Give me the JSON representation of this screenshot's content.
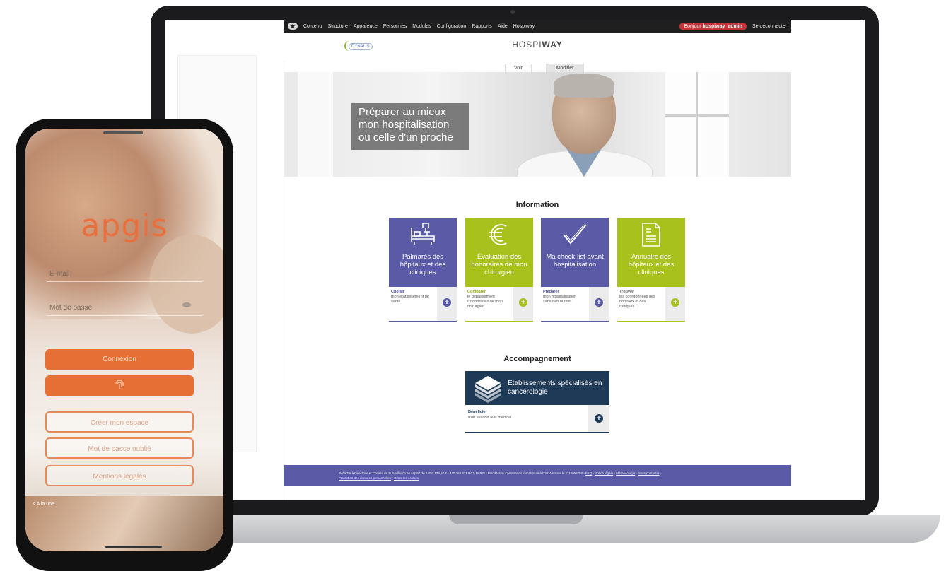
{
  "toolbar": {
    "items": [
      "Contenu",
      "Structure",
      "Apparence",
      "Personnes",
      "Modules",
      "Configuration",
      "Rapports",
      "Aide",
      "Hospiway"
    ],
    "greeting_prefix": "Bonjour",
    "user": "hospiway_admin",
    "logout": "Se déconnecter"
  },
  "header": {
    "logo": "DYNALIS",
    "title_part1": "HOSPI",
    "title_part2": "WAY"
  },
  "tabs": {
    "view": "Voir",
    "edit": "Modifier"
  },
  "hero": {
    "line1": "Préparer au mieux",
    "line2": "mon hospitalisation",
    "line3": "ou celle d'un proche"
  },
  "information": {
    "title": "Information",
    "cards": [
      {
        "title": "Palmarès des hôpitaux et des cliniques",
        "action": "Choisir",
        "desc": "mon établissement de santé",
        "icon": "hospital-bed-icon",
        "color": "#5a5aa6"
      },
      {
        "title": "Évaluation des honoraires de mon chirurgien",
        "action": "Comparer",
        "desc": "le dépassement d'honoraires de mon chirurgien",
        "icon": "euro-icon",
        "color": "#a9c11c"
      },
      {
        "title": "Ma check-list avant hospitalisation",
        "action": "Préparer",
        "desc": "mon hospitalisation sans rien oublier",
        "icon": "checkmark-icon",
        "color": "#5a5aa6"
      },
      {
        "title": "Annuaire des hôpitaux et des cliniques",
        "action": "Trouver",
        "desc": "les coordonnées des hôpitaux et des cliniques",
        "icon": "document-icon",
        "color": "#a9c11c"
      }
    ]
  },
  "accompagnement": {
    "title": "Accompagnement",
    "card": {
      "title": "Etablissements spécialisés en cancérologie",
      "action": "Bénéficier",
      "desc": "d'un second avis médical",
      "icon": "building-icon",
      "color": "#1f3a57"
    }
  },
  "footer": {
    "legal": "Relia SA à Directoire et Conseil de Surveillance au capital de 5 492 135,60 € - 440 358 471 RCS PARIS - Mandataire d'assurance immatriculé à l'ORIAS sous le n°10058750 -",
    "links": [
      "FAQ",
      "Notice légale",
      "Méthodologie",
      "Nous contacter",
      "Protection des données personnelles",
      "Gérer les cookies"
    ]
  },
  "phone": {
    "logo": "apgis",
    "email_label": "E-mail",
    "password_label": "Mot de passe",
    "connect_button": "Connexion",
    "fingerprint_icon": "fingerprint-icon",
    "create_space_button": "Créer mon espace",
    "forgot_password_button": "Mot de passe oublié",
    "legal_button": "Mentions légales",
    "bottom_label": "< A la une"
  }
}
